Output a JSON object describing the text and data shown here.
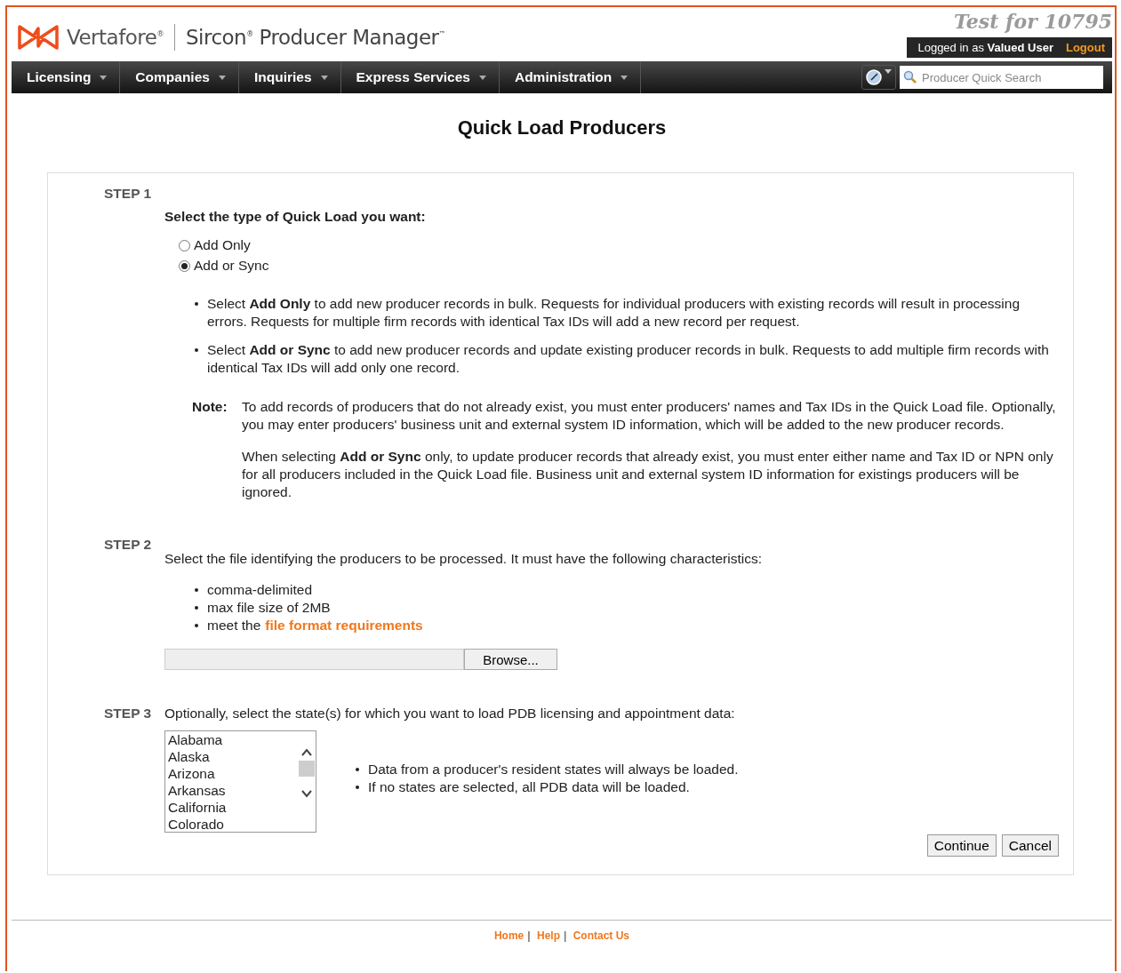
{
  "header": {
    "brand": "Vertafore$^{®}$",
    "product": "Sircon$^{®}$ Producer Manager$^{™}$",
    "environment": "Test for 10795",
    "user_text": "Logged in as **Valued User**",
    "logout": "Logout"
  },
  "nav": [
    {
      "label": "Licensing"
    },
    {
      "label": "Companies"
    },
    {
      "label": "Inquiries"
    },
    {
      "label": "Express Services"
    },
    {
      "label": "Administration"
    }
  ],
  "search": {
    "placeholder": "Producer Quick Search"
  },
  "page_title": "Quick Load Producers",
  "step1": {
    "label": "STEP 1",
    "prompt": "Select the type of Quick Load you want:",
    "options": [
      {
        "label": "Add Only",
        "selected": false
      },
      {
        "label": "Add or Sync",
        "selected": true
      }
    ],
    "bullets": [
      "Select **Add Only** to add new producer records in bulk. Requests for individual producers with existing records will result in processing errors. Requests for multiple firm records with identical Tax IDs will add a new record per request.",
      "Select **Add or Sync** to add new producer records and update existing producer records in bulk. Requests to add multiple firm records with identical Tax IDs will add only one record."
    ],
    "note_label": "Note:",
    "note_paragraphs": [
      "To add records of producers that do not already exist, you must enter producers' names and Tax IDs in the Quick Load file. Optionally, you may enter producers' business unit and external system ID information, which will be added to the new producer records.",
      "When selecting **Add or Sync** only, to update producer records that already exist, you must enter either name and Tax ID or NPN only for all producers included in the Quick Load file. Business unit and external system ID information for existings producers will be ignored."
    ]
  },
  "step2": {
    "label": "STEP 2",
    "prompt": "Select the file identifying the producers to be processed. It must have the following characteristics:",
    "bullets": [
      "comma-delimited",
      "max file size of 2MB"
    ],
    "link_prefix": "meet the",
    "link": "file format requirements",
    "browse": "Browse..."
  },
  "step3": {
    "label": "STEP 3",
    "prompt": "Optionally, select the state(s) for which you want to load PDB licensing and appointment data:",
    "states": [
      "Alabama",
      "Alaska",
      "Arizona",
      "Arkansas",
      "California",
      "Colorado"
    ],
    "bullets": [
      "Data from a producer's resident states will always be loaded.",
      "If no states are selected, all PDB data will be loaded."
    ]
  },
  "buttons": [
    "Continue",
    "Cancel"
  ],
  "footer": {
    "links": [
      "Home",
      "Help",
      "Contact Us"
    ],
    "separator": "|"
  }
}
